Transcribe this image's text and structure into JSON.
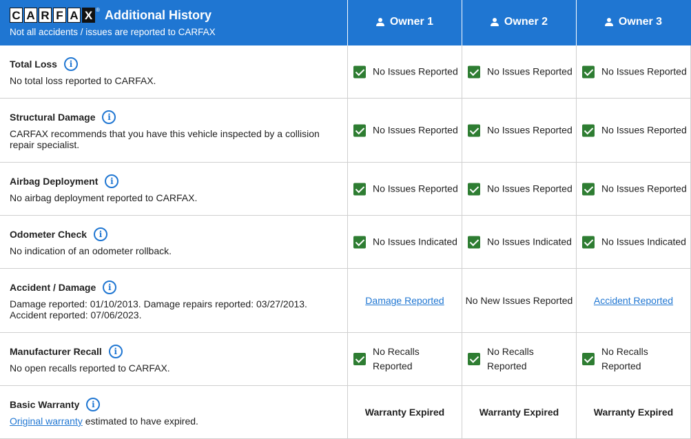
{
  "header": {
    "logo_letters": [
      "C",
      "A",
      "R",
      "F",
      "A",
      "X"
    ],
    "logo_mark": "®",
    "title": "Additional History",
    "subtitle": "Not all accidents / issues are reported to CARFAX",
    "owners": [
      "Owner 1",
      "Owner 2",
      "Owner 3"
    ],
    "colors": {
      "header_bg": "#1f76d2",
      "check_green": "#2e7d32",
      "link_blue": "#1f76d2"
    }
  },
  "rows": [
    {
      "label": "Total Loss",
      "description": "No total loss reported to CARFAX.",
      "cells": [
        "No Issues Reported",
        "No Issues Reported",
        "No Issues Reported"
      ]
    },
    {
      "label": "Structural Damage",
      "description": "CARFAX recommends that you have this vehicle inspected by a collision repair specialist.",
      "cells": [
        "No Issues Reported",
        "No Issues Reported",
        "No Issues Reported"
      ]
    },
    {
      "label": "Airbag Deployment",
      "description": "No airbag deployment reported to CARFAX.",
      "cells": [
        "No Issues Reported",
        "No Issues Reported",
        "No Issues Reported"
      ]
    },
    {
      "label": "Odometer Check",
      "description": "No indication of an odometer rollback.",
      "cells": [
        "No Issues Indicated",
        "No Issues Indicated",
        "No Issues Indicated"
      ]
    },
    {
      "label": "Accident / Damage",
      "description_line1": "Damage reported: 01/10/2013. Damage repairs reported: 03/27/2013.",
      "description_line2": "Accident reported: 07/06/2023.",
      "cells": [
        "Damage Reported",
        "No New Issues Reported",
        "Accident Reported"
      ]
    },
    {
      "label": "Manufacturer Recall",
      "description": "No open recalls reported to CARFAX.",
      "cells_line1": [
        "No Recalls",
        "No Recalls",
        "No Recalls"
      ],
      "cells_line2": [
        "Reported",
        "Reported",
        "Reported"
      ]
    },
    {
      "label": "Basic Warranty",
      "description_link": "Original warranty",
      "description_rest": " estimated to have expired.",
      "cells": [
        "Warranty Expired",
        "Warranty Expired",
        "Warranty Expired"
      ]
    }
  ],
  "icons": {
    "info": "info-icon",
    "check": "check-icon",
    "owner": "person-icon"
  },
  "info_glyph": "i"
}
